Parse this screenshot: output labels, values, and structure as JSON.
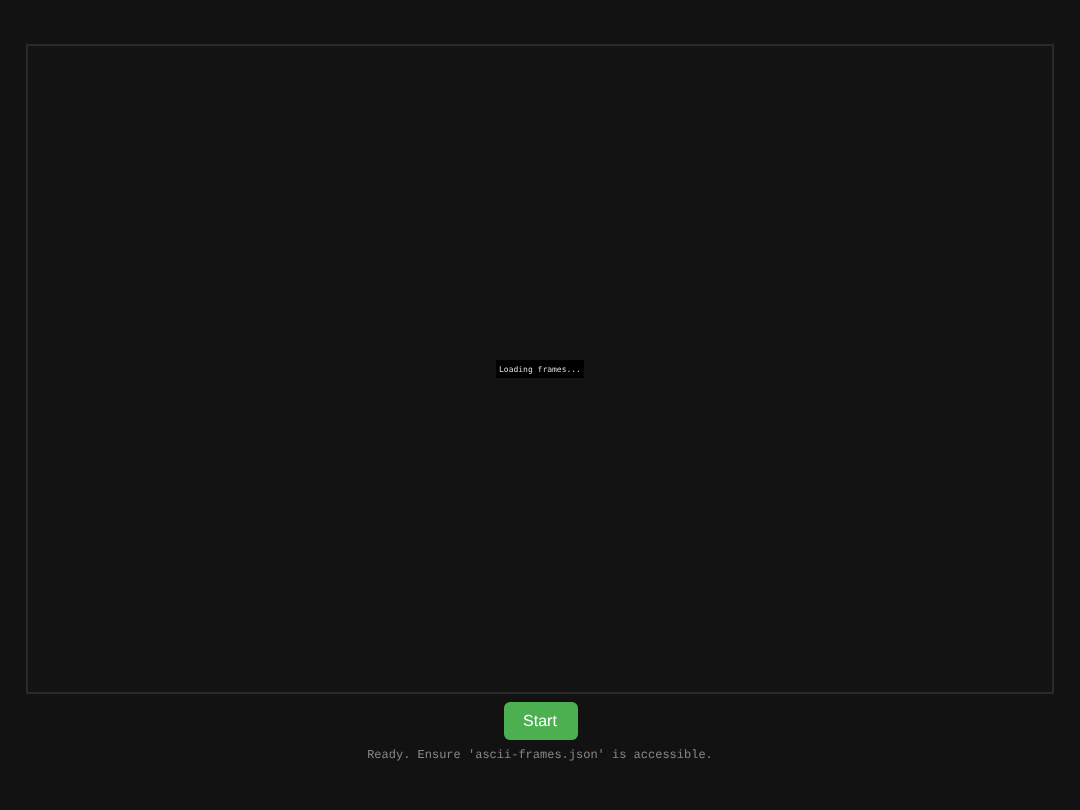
{
  "viewer": {
    "loading_text": "Loading frames..."
  },
  "start_button": {
    "label": "Start"
  },
  "status": "Ready. Ensure 'ascii-frames.json' is accessible."
}
